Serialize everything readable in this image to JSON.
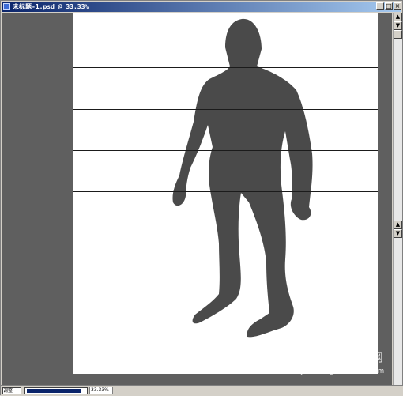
{
  "window": {
    "title": "未标题-1.psd @ 33.33%"
  },
  "statusbar": {
    "zoom": "33.33%",
    "zoom_box_label": "调整"
  },
  "watermark": {
    "line1": "查字典 教程网",
    "line2": "jiaocheng.chazidian.com"
  }
}
